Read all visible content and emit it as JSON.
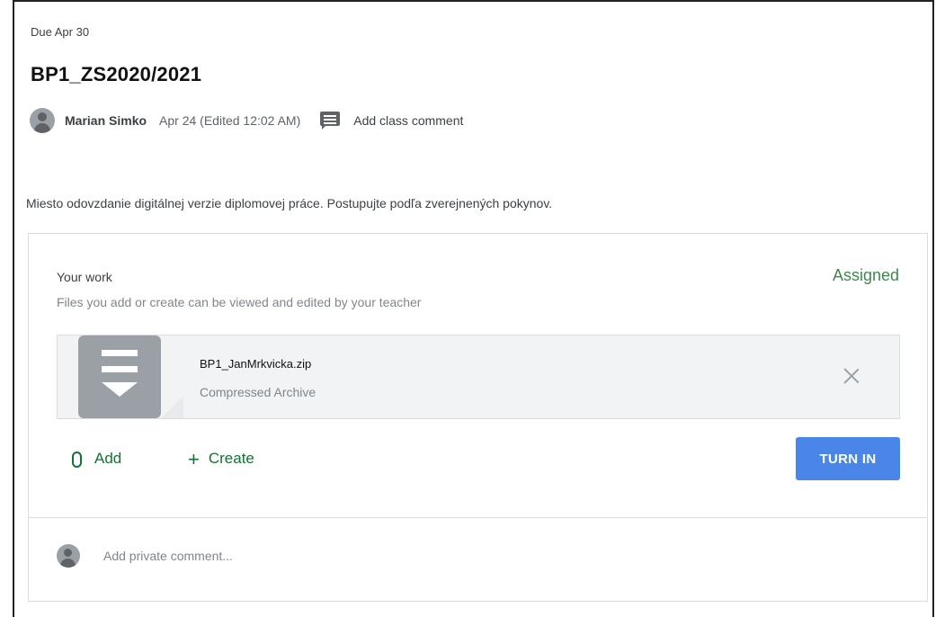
{
  "assignment": {
    "due": "Due Apr 30",
    "title": "BP1_ZS2020/2021",
    "author": "Marian Simko",
    "date": "Apr 24 (Edited 12:02 AM)",
    "add_class_comment": "Add class comment",
    "instructions": "Miesto odovzdanie digitálnej verzie diplomovej práce. Postupujte podľa zverejnených pokynov."
  },
  "your_work": {
    "title": "Your work",
    "subtitle": "Files you add or create can be viewed and edited by your teacher",
    "status": "Assigned",
    "status_color": "#3c8a4a",
    "file": {
      "name": "BP1_JanMrkvicka.zip",
      "type": "Compressed Archive",
      "icon": "archive-file-icon"
    },
    "add_label": "Add",
    "create_label": "Create",
    "turn_in_label": "TURN IN",
    "turn_in_color": "#4a86e8"
  },
  "private_comment": {
    "placeholder": "Add private comment..."
  }
}
